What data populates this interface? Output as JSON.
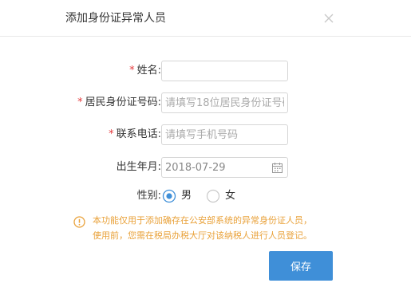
{
  "dialog": {
    "title": "添加身份证异常人员",
    "close_icon": "close-icon"
  },
  "form": {
    "name": {
      "required": "*",
      "label": "姓名:",
      "value": "",
      "placeholder": ""
    },
    "id_number": {
      "required": "*",
      "label": "居民身份证号码:",
      "value": "",
      "placeholder": "请填写18位居民身份证号码"
    },
    "phone": {
      "required": "*",
      "label": "联系电话:",
      "value": "",
      "placeholder": "请填写手机号码"
    },
    "birth": {
      "label": "出生年月:",
      "value": "2018-07-29",
      "icon": "calendar-icon"
    },
    "gender": {
      "label": "性别:",
      "options": [
        {
          "label": "男",
          "selected": true
        },
        {
          "label": "女",
          "selected": false
        }
      ]
    }
  },
  "notice": {
    "icon": "warning-icon",
    "lines": [
      "本功能仅用于添加确存在公安部系统的异常身份证人员，",
      "使用前，您需在税局办税大厅对该纳税人进行人员登记。"
    ]
  },
  "colors": {
    "required": "#e4393c",
    "notice": "#e9a23b",
    "primary": "#3f8fd8"
  },
  "actions": {
    "save_label": "保存"
  }
}
